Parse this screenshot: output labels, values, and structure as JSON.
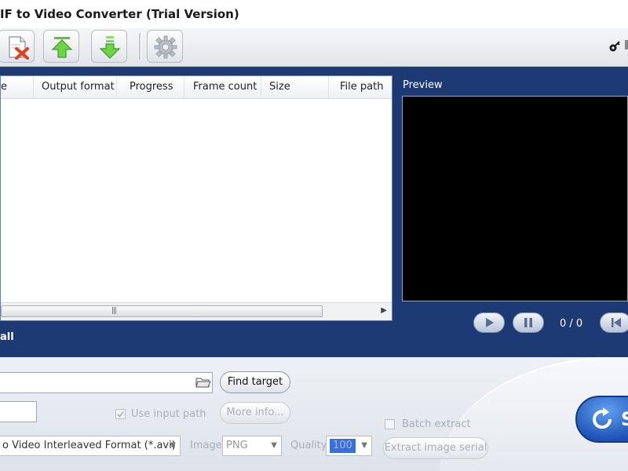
{
  "app": {
    "title": "IF to Video Converter (Trial Version)"
  },
  "toolbar": {
    "buttons": [
      {
        "name": "remove-file",
        "icon": "document-delete-icon"
      },
      {
        "name": "move-up",
        "icon": "arrow-up-icon"
      },
      {
        "name": "move-down",
        "icon": "arrow-down-icon"
      },
      {
        "name": "settings",
        "icon": "gear-icon"
      }
    ],
    "right_icon": "key-icon"
  },
  "file_list": {
    "columns": [
      "e",
      "Output format",
      "Progress",
      "Frame count",
      "Size",
      "File path"
    ],
    "rows": [],
    "footer_label": "all"
  },
  "preview": {
    "label": "Preview",
    "counter": "0 / 0",
    "controls": [
      "play-icon",
      "pause-icon",
      "skip-first-icon"
    ]
  },
  "options": {
    "target_path": "",
    "find_target_label": "Find target",
    "secondary_input": "",
    "use_input_path_label": "Use input path",
    "more_info_label": "More info...",
    "output_format": "o Video Interleaved Format (*.avi)",
    "image_label": "Image",
    "image_format": "PNG",
    "quality_label": "Quality",
    "quality_value": "100",
    "batch_extract_label": "Batch extract",
    "extract_image_serial_label": "Extract image serial",
    "start_label": "S"
  },
  "colors": {
    "panel_blue": "#1e3a74",
    "preview_black": "#000000",
    "start_blue": "#1b4fb3"
  }
}
